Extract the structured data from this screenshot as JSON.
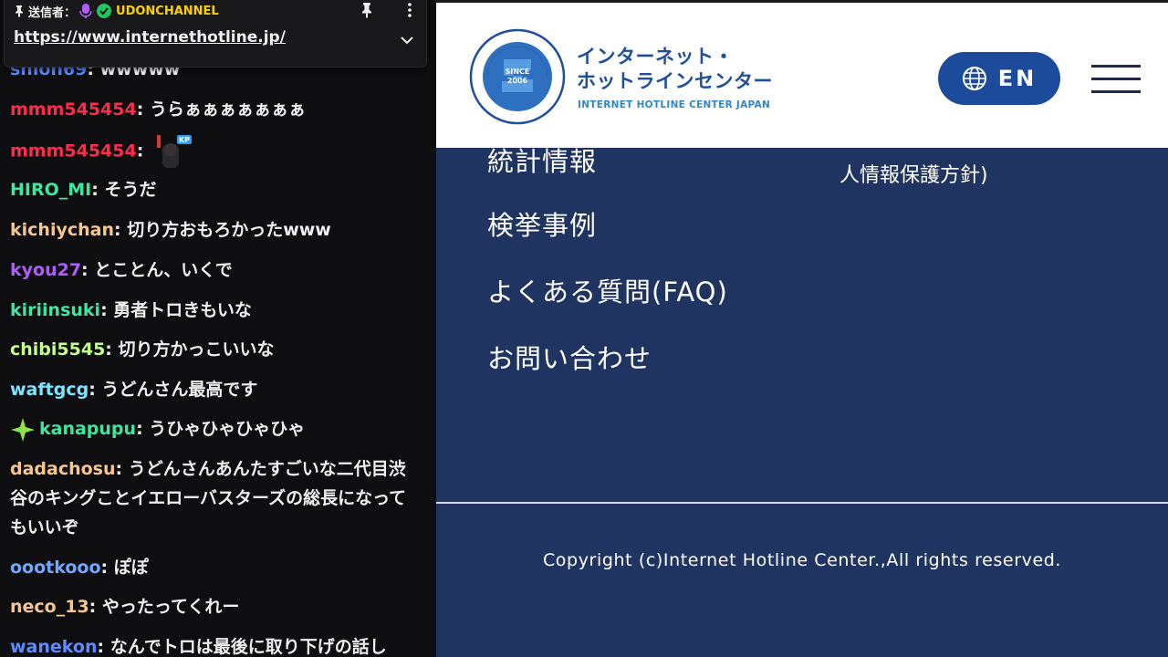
{
  "pinned": {
    "sender_label": "送信者：",
    "channel": "UDONCHANNEL",
    "url": "https://www.internethotline.jp/"
  },
  "chat": [
    {
      "user": "shion69",
      "color": "#5b8bff",
      "text": "wwwww"
    },
    {
      "user": "mmm545454",
      "color": "#ff2b4b",
      "text": "うらぁぁぁぁぁぁぁ"
    },
    {
      "user": "mmm545454",
      "color": "#ff2b4b",
      "text": "",
      "emote": "KP"
    },
    {
      "user": "HIRO_MI",
      "color": "#3ee6a0",
      "text": "そうだ"
    },
    {
      "user": "kichiychan",
      "color": "#f7c68e",
      "text": "切り方おもろかったwww"
    },
    {
      "user": "kyou27",
      "color": "#b15cff",
      "text": "とことん、いくで"
    },
    {
      "user": "kiriinsuki",
      "color": "#3ee6a0",
      "text": "勇者トロきもいな"
    },
    {
      "user": "chibi5545",
      "color": "#c4ff8f",
      "text": "切り方かっこいいな"
    },
    {
      "user": "waftgcg",
      "color": "#7fe3ff",
      "text": "うどんさん最高です"
    },
    {
      "user": "kanapupu",
      "color": "#3ee6a0",
      "text": "うひゃひゃひゃひゃ",
      "badge": "sparkle"
    },
    {
      "user": "dadachosu",
      "color": "#f7c68e",
      "text": "うどんさんあんたすごいな二代目渋谷のキングことイエローバスターズの総長になってもいいぞ"
    },
    {
      "user": "oootkooo",
      "color": "#6fa8ff",
      "text": "ぽぽ"
    },
    {
      "user": "neco_13",
      "color": "#f7c68e",
      "text": "やったってくれー"
    },
    {
      "user": "wanekon",
      "color": "#5b8bff",
      "text": "なんでトロは最後に取り下げの話し"
    }
  ],
  "site": {
    "logo_jp_line1": "インターネット・",
    "logo_jp_line2": "ホットラインセンター",
    "logo_en": "INTERNET HOTLINE CENTER JAPAN",
    "seal_since": "SINCE",
    "seal_year": "2006",
    "seal_ring_top": "INTERNET HOTLINE CENTER JAPAN",
    "seal_ring_bottom": "インターネット・ホットラインセンター",
    "lang_label": "EN",
    "nav": [
      "統計情報",
      "検挙事例",
      "よくある質問(FAQ)",
      "お問い合わせ"
    ],
    "nav_right": "人情報保護方針)",
    "copyright": "Copyright (c)Internet Hotline Center.,All rights reserved."
  },
  "colors": {
    "site_bg": "#203462",
    "brand_blue": "#1b4b9a",
    "chat_bg": "#0e0e10"
  }
}
